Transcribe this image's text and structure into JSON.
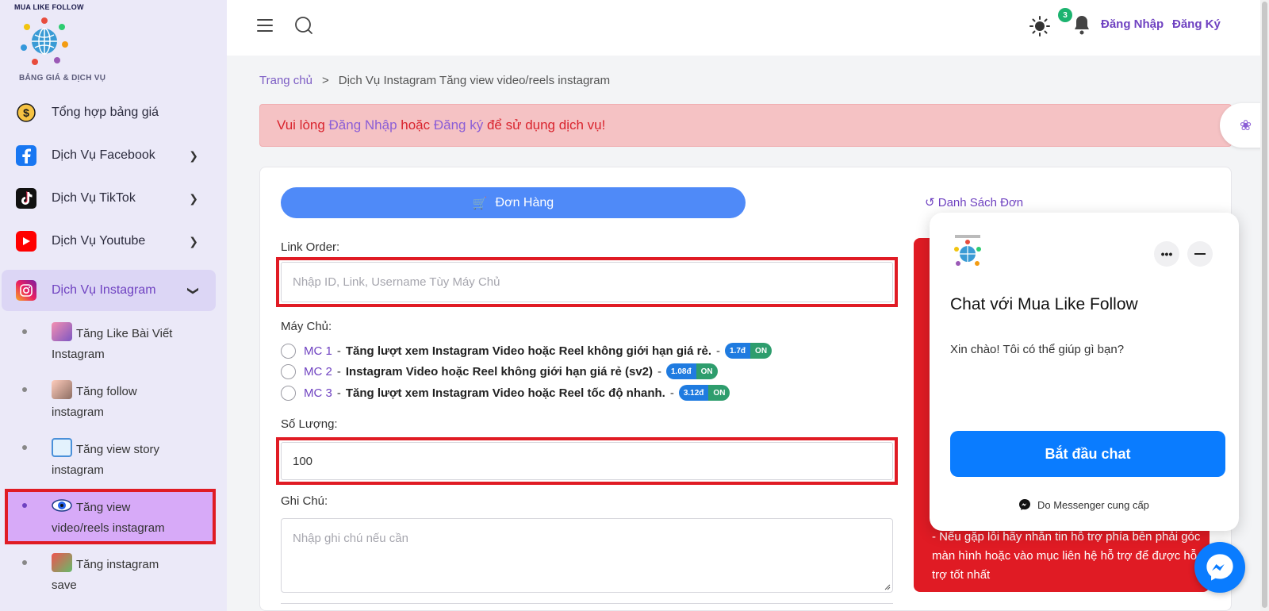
{
  "brand": {
    "name": "MUA LIKE FOLLOW",
    "section": "BẢNG GIÁ & DỊCH VỤ"
  },
  "sidebar": {
    "items": [
      {
        "label": "Tổng hợp bảng giá",
        "icon": "dollar-coin-icon"
      },
      {
        "label": "Dịch Vụ Facebook",
        "icon": "facebook-icon"
      },
      {
        "label": "Dịch Vụ TikTok",
        "icon": "tiktok-icon"
      },
      {
        "label": "Dịch Vụ Youtube",
        "icon": "youtube-icon"
      },
      {
        "label": "Dịch Vụ Instagram",
        "icon": "instagram-icon"
      }
    ],
    "sub_items": [
      {
        "line1": "Tăng Like Bài Viết",
        "line2": "Instagram"
      },
      {
        "line1": "Tăng follow",
        "line2": "instagram"
      },
      {
        "line1": "Tăng view story",
        "line2": "instagram"
      },
      {
        "line1": "Tăng view",
        "line2": "video/reels instagram"
      },
      {
        "line1": "Tăng instagram",
        "line2": "save"
      }
    ]
  },
  "header": {
    "login": "Đăng Nhập",
    "register": "Đăng Ký",
    "notification_count": "3"
  },
  "breadcrumb": {
    "home": "Trang chủ",
    "sep": ">",
    "current": "Dịch Vụ Instagram Tăng view video/reels instagram"
  },
  "alert": {
    "prefix": "Vui lòng ",
    "login": "Đăng Nhập",
    "middle": " hoặc ",
    "register": "Đăng ký",
    "suffix": " để sử dụng dịch vụ!"
  },
  "tabs": {
    "order": "Đơn Hàng",
    "list": "Danh Sách Đơn"
  },
  "form": {
    "link_label": "Link Order:",
    "link_placeholder": "Nhập ID, Link, Username Tùy Máy Chủ",
    "server_label": "Máy Chủ:",
    "servers": [
      {
        "code": "MC 1",
        "name": "Tăng lượt xem Instagram Video hoặc Reel không giới hạn giá rẻ.",
        "price": "1.7đ",
        "status": "ON"
      },
      {
        "code": "MC 2",
        "name": "Instagram Video hoặc Reel không giới hạn giá rẻ (sv2)",
        "price": "1.08đ",
        "status": "ON"
      },
      {
        "code": "MC 3",
        "name": "Tăng lượt xem Instagram Video hoặc Reel tốc độ nhanh.",
        "price": "3.12đ",
        "status": "ON"
      }
    ],
    "dash": "-",
    "quantity_label": "Số Lượng:",
    "quantity_value": "100",
    "note_label": "Ghi Chú:",
    "note_placeholder": "Nhập ghi chú nếu cần"
  },
  "red_panel": {
    "text": "- Nếu gặp lỗi hãy nhắn tin hỗ trợ phía bên phải góc màn hình hoặc vào mục liên hệ hỗ trợ để được hỗ trợ tốt nhất"
  },
  "chat": {
    "title": "Chat với Mua Like Follow",
    "greeting": "Xin chào! Tôi có thể giúp gì bạn?",
    "start": "Bắt đầu chat",
    "footer": "Do Messenger cung cấp"
  },
  "colors": {
    "accent": "#6f42c1",
    "primary_button": "#4f8af8",
    "alert_bg": "#f5c2c4",
    "alert_text": "#d9232d",
    "highlight_red": "#e01b24",
    "messenger_blue": "#0a7cff"
  }
}
